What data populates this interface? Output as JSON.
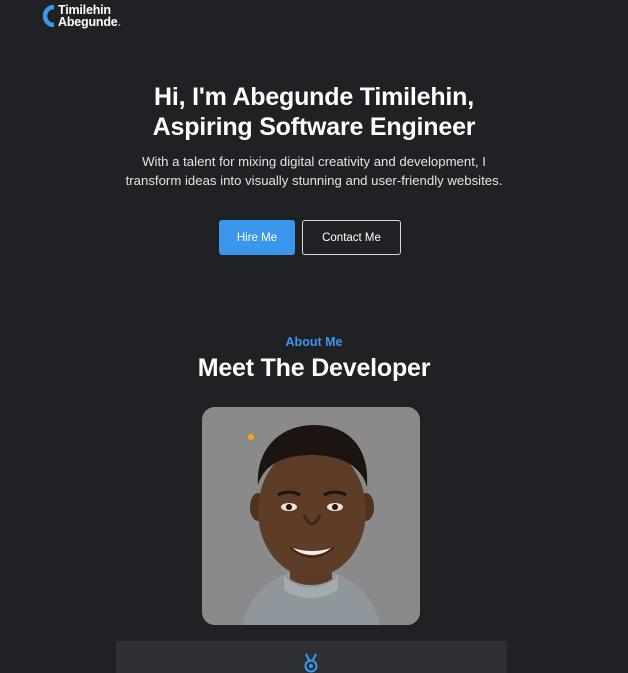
{
  "header": {
    "logo_line1": "Timilehin",
    "logo_line2": "Abegunde",
    "logo_dot": "."
  },
  "hero": {
    "title_line1": "Hi, I'm Abegunde Timilehin,",
    "title_line2": "Aspiring Software Engineer",
    "description": "With a talent for mixing digital creativity and development, I transform ideas into visually stunning and user-friendly websites.",
    "hire_label": "Hire Me",
    "contact_label": "Contact Me"
  },
  "about": {
    "eyebrow": "About Me",
    "title": "Meet The Developer"
  },
  "icons": {
    "logo": "logo-c-mark-icon",
    "card": "medal-icon"
  },
  "colors": {
    "background": "#202124",
    "accent": "#3b97ec",
    "photo_bg": "#8a8a8a",
    "card_bg": "#2f3034",
    "dot": "#f3a51f"
  }
}
